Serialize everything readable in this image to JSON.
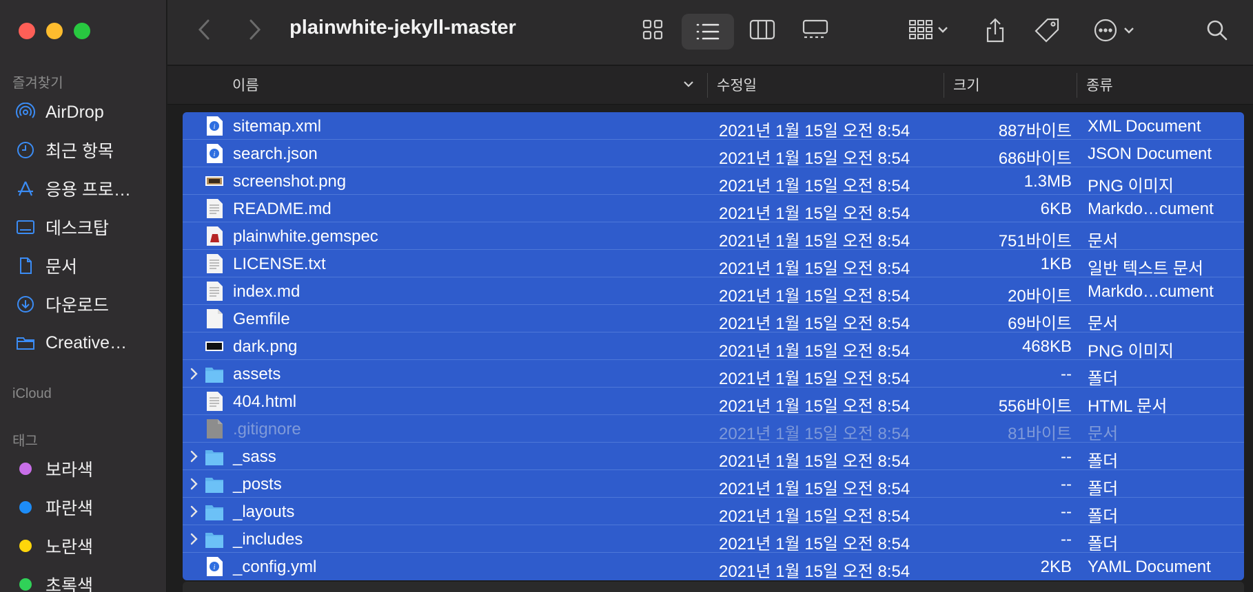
{
  "sidebar": {
    "favorites_label": "즐겨찾기",
    "items": [
      {
        "label": "AirDrop",
        "icon": "airdrop-icon"
      },
      {
        "label": "최근 항목",
        "icon": "clock-icon"
      },
      {
        "label": "응용 프로…",
        "icon": "applications-icon"
      },
      {
        "label": "데스크탑",
        "icon": "desktop-icon"
      },
      {
        "label": "문서",
        "icon": "document-icon"
      },
      {
        "label": "다운로드",
        "icon": "download-icon"
      },
      {
        "label": "Creative…",
        "icon": "folder-icon"
      }
    ],
    "icloud_label": "iCloud",
    "tags_label": "태그",
    "tags": [
      {
        "label": "보라색",
        "color": "#c86ee8"
      },
      {
        "label": "파란색",
        "color": "#1d8cf7"
      },
      {
        "label": "노란색",
        "color": "#ffd60a"
      },
      {
        "label": "초록색",
        "color": "#30d158"
      }
    ]
  },
  "toolbar": {
    "title": "plainwhite-jekyll-master"
  },
  "columns": {
    "name": "이름",
    "modified": "수정일",
    "size": "크기",
    "kind": "종류"
  },
  "files": [
    {
      "name": "sitemap.xml",
      "date": "2021년 1월 15일 오전 8:54",
      "size": "887바이트",
      "kind": "XML Document",
      "icon": "xml-file-icon",
      "folder": false,
      "dim": false
    },
    {
      "name": "search.json",
      "date": "2021년 1월 15일 오전 8:54",
      "size": "686바이트",
      "kind": "JSON Document",
      "icon": "json-file-icon",
      "folder": false,
      "dim": false
    },
    {
      "name": "screenshot.png",
      "date": "2021년 1월 15일 오전 8:54",
      "size": "1.3MB",
      "kind": "PNG 이미지",
      "icon": "image-file-icon",
      "folder": false,
      "dim": false
    },
    {
      "name": "README.md",
      "date": "2021년 1월 15일 오전 8:54",
      "size": "6KB",
      "kind": "Markdo…cument",
      "icon": "text-file-icon",
      "folder": false,
      "dim": false
    },
    {
      "name": "plainwhite.gemspec",
      "date": "2021년 1월 15일 오전 8:54",
      "size": "751바이트",
      "kind": "문서",
      "icon": "gemspec-file-icon",
      "folder": false,
      "dim": false
    },
    {
      "name": "LICENSE.txt",
      "date": "2021년 1월 15일 오전 8:54",
      "size": "1KB",
      "kind": "일반 텍스트 문서",
      "icon": "text-file-icon",
      "folder": false,
      "dim": false
    },
    {
      "name": "index.md",
      "date": "2021년 1월 15일 오전 8:54",
      "size": "20바이트",
      "kind": "Markdo…cument",
      "icon": "text-file-icon",
      "folder": false,
      "dim": false
    },
    {
      "name": "Gemfile",
      "date": "2021년 1월 15일 오전 8:54",
      "size": "69바이트",
      "kind": "문서",
      "icon": "blank-file-icon",
      "folder": false,
      "dim": false
    },
    {
      "name": "dark.png",
      "date": "2021년 1월 15일 오전 8:54",
      "size": "468KB",
      "kind": "PNG 이미지",
      "icon": "dark-image-file-icon",
      "folder": false,
      "dim": false
    },
    {
      "name": "assets",
      "date": "2021년 1월 15일 오전 8:54",
      "size": "--",
      "kind": "폴더",
      "icon": "folder-icon",
      "folder": true,
      "dim": false
    },
    {
      "name": "404.html",
      "date": "2021년 1월 15일 오전 8:54",
      "size": "556바이트",
      "kind": "HTML 문서",
      "icon": "text-file-icon",
      "folder": false,
      "dim": false
    },
    {
      "name": ".gitignore",
      "date": "2021년 1월 15일 오전 8:54",
      "size": "81바이트",
      "kind": "문서",
      "icon": "hidden-file-icon",
      "folder": false,
      "dim": true
    },
    {
      "name": "_sass",
      "date": "2021년 1월 15일 오전 8:54",
      "size": "--",
      "kind": "폴더",
      "icon": "folder-icon",
      "folder": true,
      "dim": false
    },
    {
      "name": "_posts",
      "date": "2021년 1월 15일 오전 8:54",
      "size": "--",
      "kind": "폴더",
      "icon": "folder-icon",
      "folder": true,
      "dim": false
    },
    {
      "name": "_layouts",
      "date": "2021년 1월 15일 오전 8:54",
      "size": "--",
      "kind": "폴더",
      "icon": "folder-icon",
      "folder": true,
      "dim": false
    },
    {
      "name": "_includes",
      "date": "2021년 1월 15일 오전 8:54",
      "size": "--",
      "kind": "폴더",
      "icon": "folder-icon",
      "folder": true,
      "dim": false
    },
    {
      "name": "_config.yml",
      "date": "2021년 1월 15일 오전 8:54",
      "size": "2KB",
      "kind": "YAML Document",
      "icon": "yaml-file-icon",
      "folder": false,
      "dim": false
    }
  ],
  "colors": {
    "selection": "#2f5ccc",
    "sidebar_bg": "#2f2d2f",
    "accent": "#3b8cf5"
  }
}
